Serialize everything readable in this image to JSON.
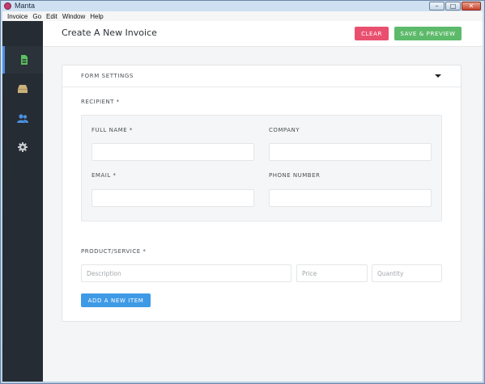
{
  "window": {
    "title": "Manta"
  },
  "menu": [
    "Invoice",
    "Go",
    "Edit",
    "Window",
    "Help"
  ],
  "sidebar": {
    "items": [
      {
        "icon": "document-icon",
        "active": true
      },
      {
        "icon": "inbox-icon",
        "active": false
      },
      {
        "icon": "contacts-icon",
        "active": false
      },
      {
        "icon": "gear-icon",
        "active": false
      }
    ]
  },
  "header": {
    "title": "Create A New Invoice",
    "clear_label": "CLEAR",
    "save_label": "SAVE & PREVIEW"
  },
  "form": {
    "settings_label": "FORM SETTINGS",
    "recipient_label": "RECIPIENT *",
    "full_name_label": "FULL NAME *",
    "company_label": "COMPANY",
    "email_label": "EMAIL *",
    "phone_label": "PHONE NUMBER",
    "product_label": "PRODUCT/SERVICE *",
    "description_placeholder": "Description",
    "price_placeholder": "Price",
    "quantity_placeholder": "Quantity",
    "add_item_label": "ADD A NEW ITEM"
  },
  "colors": {
    "sidebar": "#262c33",
    "clear": "#e9506f",
    "save": "#5dba6a",
    "add": "#3f9ae6",
    "active_icon": "#5cc160",
    "contacts_icon": "#4a90e2"
  }
}
